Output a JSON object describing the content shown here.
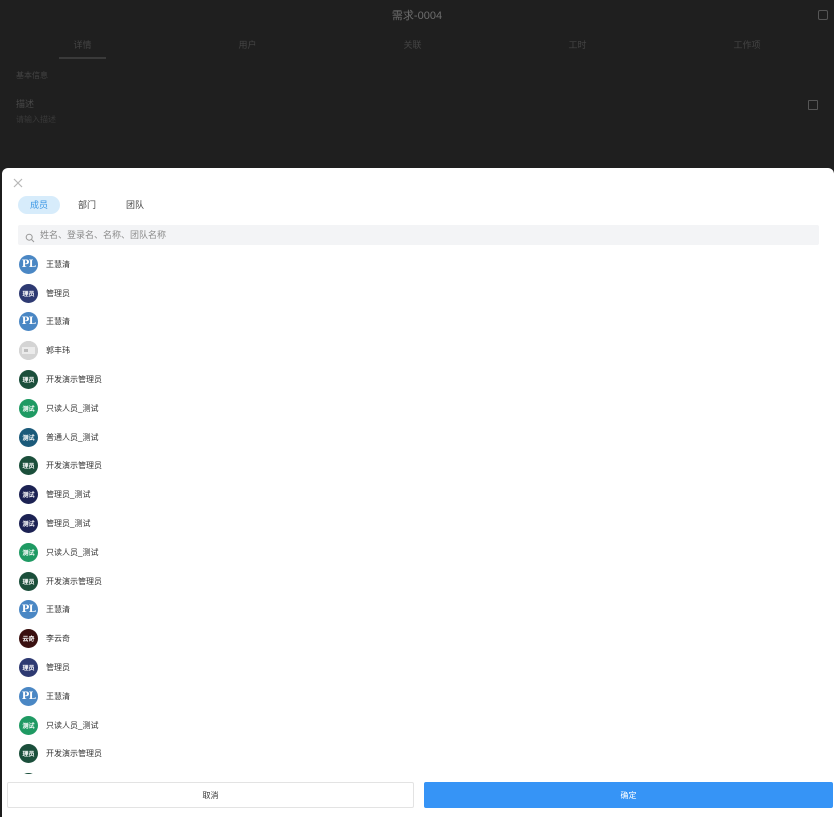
{
  "background": {
    "title": "需求-0004",
    "tabs": [
      "详情",
      "用户",
      "关联",
      "工时",
      "工作项"
    ],
    "section_label": "基本信息",
    "field_label": "描述",
    "field_value": "请输入描述"
  },
  "sheet": {
    "tabs": [
      {
        "label": "成员",
        "active": true
      },
      {
        "label": "部门",
        "active": false
      },
      {
        "label": "团队",
        "active": false
      }
    ],
    "search": {
      "placeholder": "姓名、登录名、名称、团队名称",
      "value": ""
    },
    "members": [
      {
        "name": "王慧清",
        "avatar_text": "PL",
        "avatar_kind": "pl",
        "color": "#4a87c4"
      },
      {
        "name": "管理员",
        "avatar_text": "理员",
        "avatar_kind": "text",
        "color": "#2e3a72"
      },
      {
        "name": "王慧清",
        "avatar_text": "PL",
        "avatar_kind": "pl",
        "color": "#4a87c4"
      },
      {
        "name": "郭丰玮",
        "avatar_text": "photo",
        "avatar_kind": "img",
        "color": "#c9c9c9"
      },
      {
        "name": "开发演示管理员",
        "avatar_text": "理员",
        "avatar_kind": "text",
        "color": "#1b4f3b"
      },
      {
        "name": "只读人员_测试",
        "avatar_text": "测试",
        "avatar_kind": "text",
        "color": "#1f9a63"
      },
      {
        "name": "普通人员_测试",
        "avatar_text": "测试",
        "avatar_kind": "text",
        "color": "#1b5a7a"
      },
      {
        "name": "开发演示管理员",
        "avatar_text": "理员",
        "avatar_kind": "text",
        "color": "#1b4f3b"
      },
      {
        "name": "管理员_测试",
        "avatar_text": "测试",
        "avatar_kind": "text",
        "color": "#1c2253"
      },
      {
        "name": "管理员_测试",
        "avatar_text": "测试",
        "avatar_kind": "text",
        "color": "#1c2253"
      },
      {
        "name": "只读人员_测试",
        "avatar_text": "测试",
        "avatar_kind": "text",
        "color": "#1f9a63"
      },
      {
        "name": "开发演示管理员",
        "avatar_text": "理员",
        "avatar_kind": "text",
        "color": "#1b4f3b"
      },
      {
        "name": "王慧清",
        "avatar_text": "PL",
        "avatar_kind": "pl",
        "color": "#4a87c4"
      },
      {
        "name": "李云奇",
        "avatar_text": "云奇",
        "avatar_kind": "text",
        "color": "#3a1010"
      },
      {
        "name": "管理员",
        "avatar_text": "理员",
        "avatar_kind": "text",
        "color": "#2e3a72"
      },
      {
        "name": "王慧清",
        "avatar_text": "PL",
        "avatar_kind": "pl",
        "color": "#4a87c4"
      },
      {
        "name": "只读人员_测试",
        "avatar_text": "测试",
        "avatar_kind": "text",
        "color": "#1f9a63"
      },
      {
        "name": "开发演示管理员",
        "avatar_text": "理员",
        "avatar_kind": "text",
        "color": "#1b4f3b"
      },
      {
        "name": "",
        "avatar_text": "",
        "avatar_kind": "text",
        "color": "#1b4f3b"
      }
    ],
    "footer": {
      "cancel_label": "取消",
      "confirm_label": "确定"
    }
  },
  "colors": {
    "accent": "#3694f6",
    "tab_active_bg": "#d7ecfb",
    "tab_active_text": "#3b97e6",
    "backdrop": "#1c1c1c"
  }
}
